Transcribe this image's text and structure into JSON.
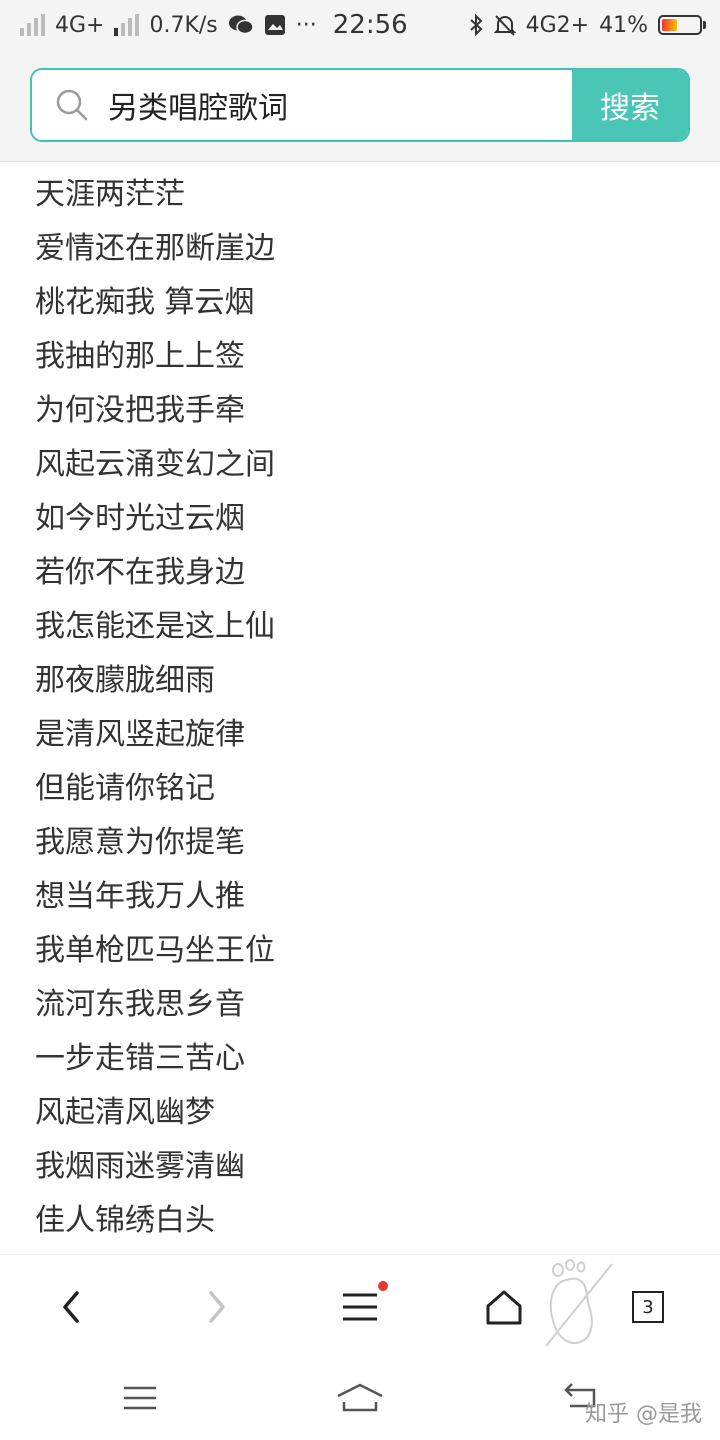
{
  "status_bar": {
    "network_left": "4G+",
    "speed": "0.7K/s",
    "time": "22:56",
    "network_right": "4G2+",
    "battery": "41%",
    "icons": [
      "signal-icon",
      "wechat-icon",
      "gallery-icon",
      "more-dots-icon",
      "bluetooth-icon",
      "mute-icon",
      "battery-icon"
    ]
  },
  "search": {
    "query": "另类唱腔歌词",
    "button_label": "搜索",
    "accent_color": "#4ac6b7"
  },
  "lyrics": [
    "天涯两茫茫",
    "爱情还在那断崖边",
    "桃花痴我 算云烟",
    "我抽的那上上签",
    "为何没把我手牵",
    "风起云涌变幻之间",
    "如今时光过云烟",
    "若你不在我身边",
    "我怎能还是这上仙",
    "那夜朦胧细雨",
    "是清风竖起旋律",
    "但能请你铭记",
    "我愿意为你提笔",
    "想当年我万人推",
    "我单枪匹马坐王位",
    "流河东我思乡音",
    "一步走错三苦心",
    "风起清风幽梦",
    "我烟雨迷雾清幽",
    "佳人锦绣白头"
  ],
  "toolbar": {
    "tab_count": "3",
    "icons": [
      "back-icon",
      "forward-icon",
      "menu-icon",
      "home-icon",
      "footprint-icon",
      "tabs-icon"
    ]
  },
  "watermark": "知乎 @是我"
}
